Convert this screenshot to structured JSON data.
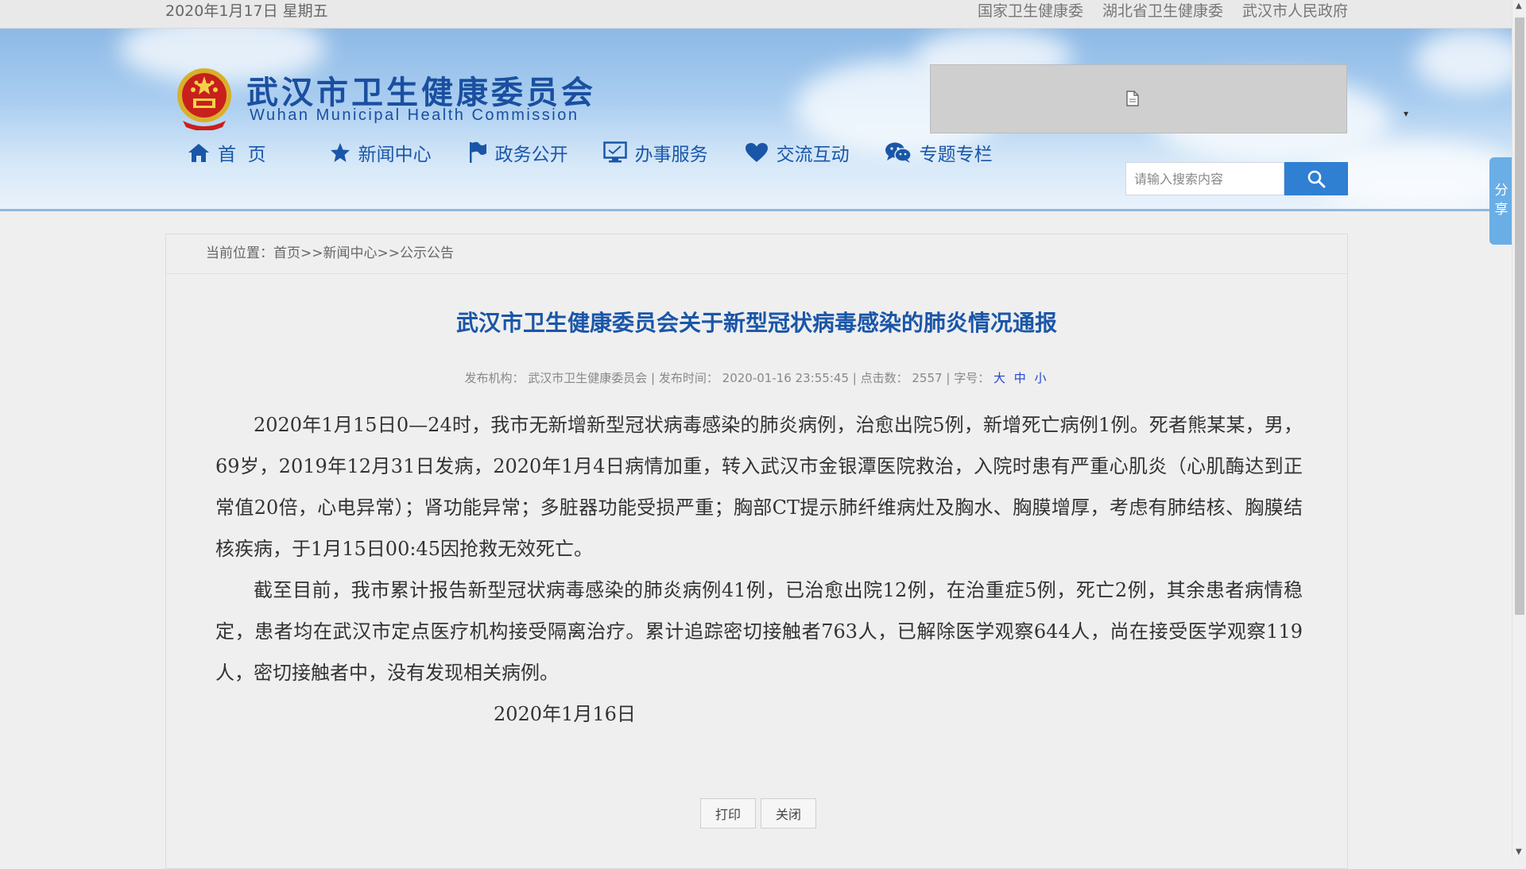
{
  "topbar": {
    "date": "2020年1月17日 星期五",
    "links": [
      "国家卫生健康委",
      "湖北省卫生健康委",
      "武汉市人民政府"
    ]
  },
  "header": {
    "title_cn": "武汉市卫生健康委员会",
    "title_en": "Wuhan Municipal Health Commission"
  },
  "nav": {
    "items": [
      {
        "label": "首  页",
        "icon": "home-icon"
      },
      {
        "label": "新闻中心",
        "icon": "star-icon"
      },
      {
        "label": "政务公开",
        "icon": "flag-icon"
      },
      {
        "label": "办事服务",
        "icon": "monitor-icon"
      },
      {
        "label": "交流互动",
        "icon": "heart-icon"
      },
      {
        "label": "专题专栏",
        "icon": "wechat-icon"
      }
    ]
  },
  "search": {
    "placeholder": "请输入搜索内容"
  },
  "share": {
    "label": "分享"
  },
  "breadcrumb": {
    "prefix": "当前位置：",
    "items": [
      "首页",
      "新闻中心",
      "公示公告"
    ],
    "sep": ">>"
  },
  "article": {
    "title": "武汉市卫生健康委员会关于新型冠状病毒感染的肺炎情况通报",
    "meta": {
      "publisher_label": "发布机构：",
      "publisher": "武汉市卫生健康委员会",
      "time_label": "发布时间：",
      "time": "2020-01-16 23:55:45",
      "clicks_label": "点击数：",
      "clicks": "2557",
      "fontsize_label": "字号：",
      "fontsize_options": "大 中 小"
    },
    "paragraphs": [
      "2020年1月15日0—24时，我市无新增新型冠状病毒感染的肺炎病例，治愈出院5例，新增死亡病例1例。死者熊某某，男，69岁，2019年12月31日发病，2020年1月4日病情加重，转入武汉市金银潭医院救治，入院时患有严重心肌炎（心肌酶达到正常值20倍，心电异常）；肾功能异常；多脏器功能受损严重；胸部CT提示肺纤维病灶及胸水、胸膜增厚，考虑有肺结核、胸膜结核疾病，于1月15日00:45因抢救无效死亡。",
      "截至目前，我市累计报告新型冠状病毒感染的肺炎病例41例，已治愈出院12例，在治重症5例，死亡2例，其余患者病情稳定，患者均在武汉市定点医疗机构接受隔离治疗。累计追踪密切接触者763人，已解除医学观察644人，尚在接受医学观察119人，密切接触者中，没有发现相关病例。"
    ],
    "date_sign": "2020年1月16日"
  },
  "buttons": {
    "print": "打印",
    "close": "关闭"
  },
  "colors": {
    "accent": "#1a56a8",
    "search_button": "#2f7fd3",
    "fontsize_link": "#2244cc"
  }
}
